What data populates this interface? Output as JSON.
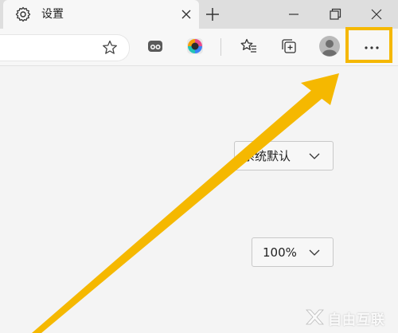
{
  "tab": {
    "title": "设置",
    "icon": "gear-icon"
  },
  "toolbar": {
    "icons": [
      "star-icon",
      "extension-icon",
      "color-wheel-icon",
      "favorites-icon",
      "collections-icon",
      "profile-avatar-icon",
      "more-options-icon"
    ],
    "more_label": "···"
  },
  "settings": {
    "theme_dropdown": {
      "value": "系统默认"
    },
    "zoom_dropdown": {
      "value": "100%"
    }
  },
  "annotation": {
    "color": "#f5b800",
    "target": "more-options-button"
  },
  "watermark": {
    "text": "自由互联"
  }
}
